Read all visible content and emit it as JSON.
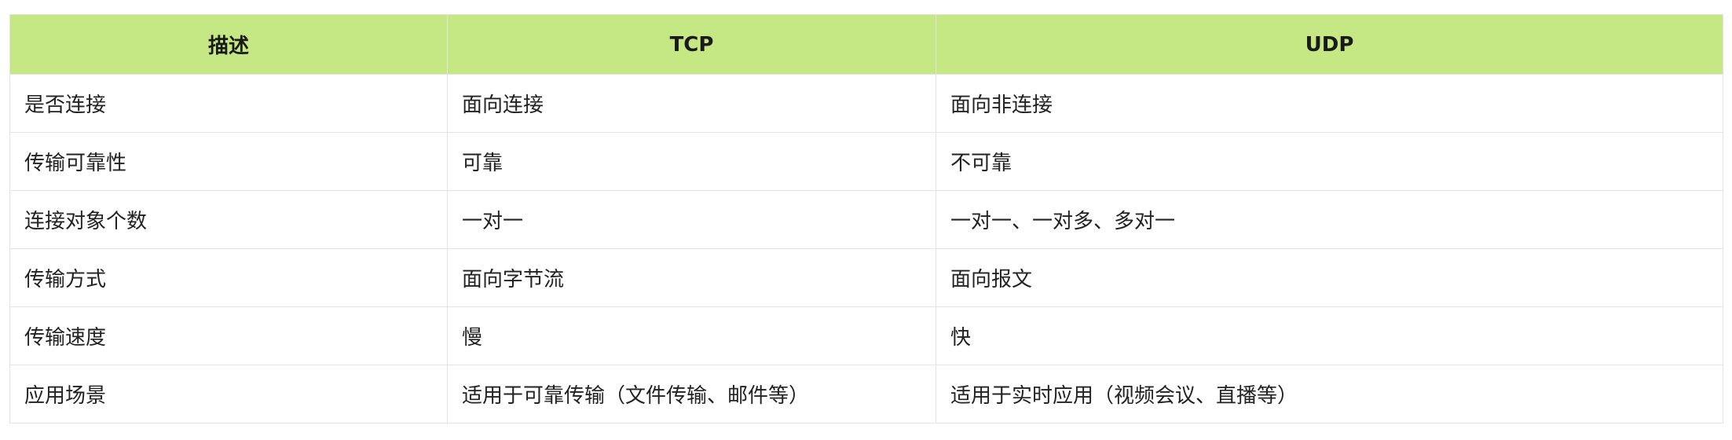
{
  "table": {
    "headers": [
      "描述",
      "TCP",
      "UDP"
    ],
    "rows": [
      [
        "是否连接",
        "面向连接",
        "面向非连接"
      ],
      [
        "传输可靠性",
        "可靠",
        "不可靠"
      ],
      [
        "连接对象个数",
        "一对一",
        "一对一、一对多、多对一"
      ],
      [
        "传输方式",
        "面向字节流",
        "面向报文"
      ],
      [
        "传输速度",
        "慢",
        "快"
      ],
      [
        "应用场景",
        "适用于可靠传输（文件传输、邮件等）",
        "适用于实时应用（视频会议、直播等）"
      ]
    ]
  },
  "colors": {
    "header_background": "#c5e884",
    "border": "#e3e3e3"
  }
}
